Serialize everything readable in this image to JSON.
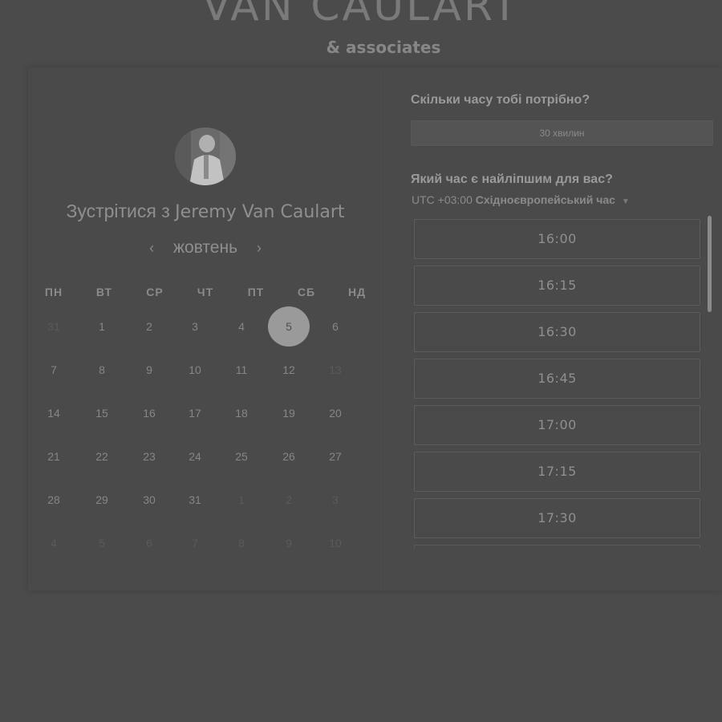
{
  "brand": {
    "title": "VAN CAULART",
    "subtitle": "& associates"
  },
  "booking": {
    "title_prefix": "Зустрітися з",
    "host_name": "Jeremy Van Caulart",
    "month": "жовтень",
    "prev_icon": "chevron-left-icon",
    "next_icon": "chevron-right-icon",
    "weekdays": [
      "ПН",
      "ВТ",
      "СР",
      "ЧТ",
      "ПТ",
      "СБ",
      "НД"
    ],
    "weeks": [
      [
        {
          "d": "31",
          "m": true
        },
        {
          "d": "1"
        },
        {
          "d": "2"
        },
        {
          "d": "3"
        },
        {
          "d": "4"
        },
        {
          "d": "5",
          "sel": true
        },
        {
          "d": "6"
        }
      ],
      [
        {
          "d": "7"
        },
        {
          "d": "8"
        },
        {
          "d": "9"
        },
        {
          "d": "10"
        },
        {
          "d": "11"
        },
        {
          "d": "12"
        },
        {
          "d": "13",
          "m": true
        }
      ],
      [
        {
          "d": "14"
        },
        {
          "d": "15"
        },
        {
          "d": "16"
        },
        {
          "d": "17"
        },
        {
          "d": "18"
        },
        {
          "d": "19"
        },
        {
          "d": "20"
        }
      ],
      [
        {
          "d": "21"
        },
        {
          "d": "22"
        },
        {
          "d": "23"
        },
        {
          "d": "24"
        },
        {
          "d": "25"
        },
        {
          "d": "26"
        },
        {
          "d": "27"
        }
      ],
      [
        {
          "d": "28"
        },
        {
          "d": "29"
        },
        {
          "d": "30"
        },
        {
          "d": "31"
        },
        {
          "d": "1",
          "m": true
        },
        {
          "d": "2",
          "m": true
        },
        {
          "d": "3",
          "m": true
        }
      ],
      [
        {
          "d": "4",
          "m": true
        },
        {
          "d": "5",
          "m": true
        },
        {
          "d": "6",
          "m": true
        },
        {
          "d": "7",
          "m": true
        },
        {
          "d": "8",
          "m": true
        },
        {
          "d": "9",
          "m": true
        },
        {
          "d": "10",
          "m": true
        }
      ]
    ]
  },
  "scheduler": {
    "duration_question": "Скільки часу тобі потрібно?",
    "duration_value": "30 хвилин",
    "time_question": "Який час є найліпшим для вас?",
    "tz_offset": "UTC +03:00",
    "tz_name": "Східноєвропейський час",
    "slots": [
      "16:00",
      "16:15",
      "16:30",
      "16:45",
      "17:00",
      "17:15",
      "17:30",
      ""
    ]
  }
}
